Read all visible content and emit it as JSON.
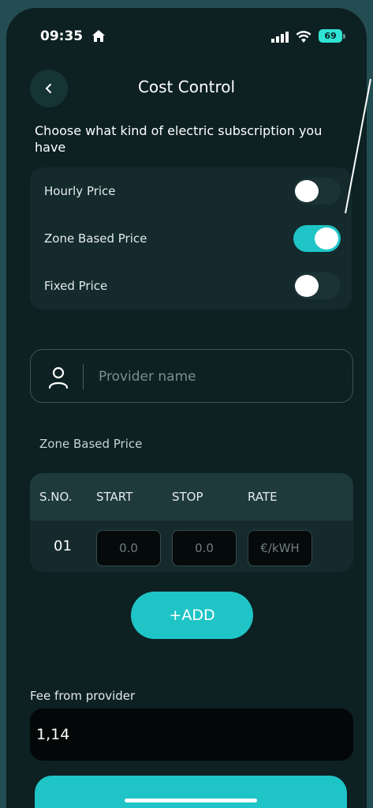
{
  "status_bar": {
    "time": "09:35",
    "battery": "69"
  },
  "header": {
    "title": "Cost Control"
  },
  "subscription": {
    "prompt": "Choose what kind of electric subscription you have",
    "options": [
      {
        "label": "Hourly Price",
        "on": false
      },
      {
        "label": "Zone Based Price",
        "on": true
      },
      {
        "label": "Fixed Price",
        "on": false
      }
    ]
  },
  "provider": {
    "placeholder": "Provider name",
    "value": ""
  },
  "zone_table": {
    "title": "Zone Based Price",
    "headers": [
      "S.NO.",
      "START",
      "STOP",
      "RATE"
    ],
    "rows": [
      {
        "sno": "01",
        "start_placeholder": "0.0",
        "stop_placeholder": "0.0",
        "rate_placeholder": "€/kWH"
      }
    ]
  },
  "add_button": {
    "label": "+ADD"
  },
  "fee": {
    "label": "Fee from provider",
    "value": "1,14"
  },
  "colors": {
    "accent": "#1fc4c6",
    "background": "#0d2022",
    "card": "#142a2c"
  },
  "icons": [
    "home-icon",
    "signal-icon",
    "wifi-icon",
    "battery-icon",
    "chevron-left-icon",
    "user-icon"
  ]
}
